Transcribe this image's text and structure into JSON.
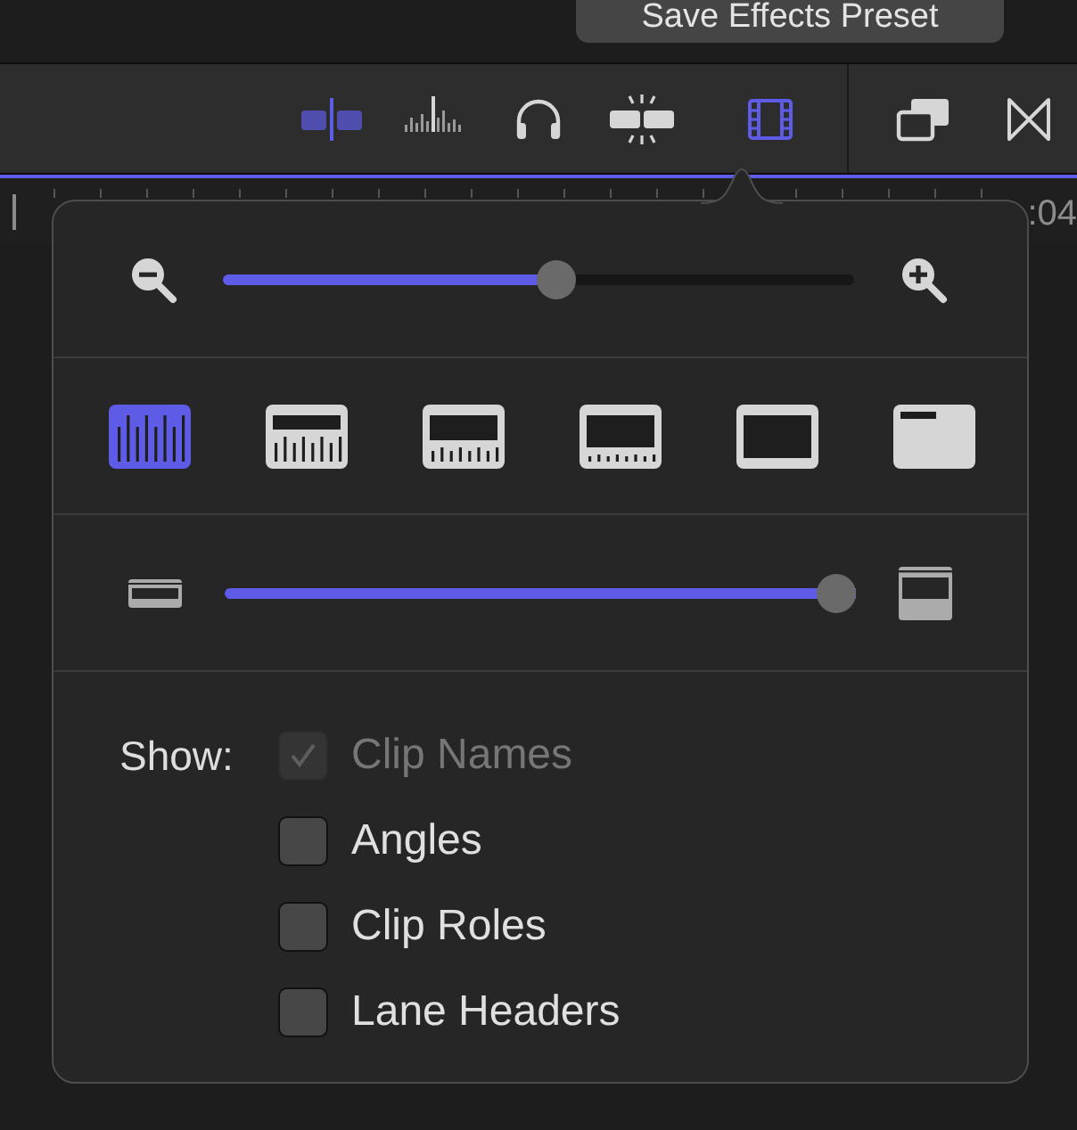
{
  "top_bar": {
    "button": "Save Effects Preset"
  },
  "toolbar": {
    "left": [
      {
        "kind": "skimming",
        "selected": true
      },
      {
        "kind": "audioskimming",
        "selected": false
      },
      {
        "kind": "solo",
        "selected": false
      },
      {
        "kind": "snapping",
        "selected": false
      },
      {
        "kind": "appearance",
        "selected": true
      }
    ],
    "right": [
      {
        "kind": "windows",
        "selected": false
      },
      {
        "kind": "transitions",
        "selected": false
      }
    ]
  },
  "ruler": {
    "timecode": ":04"
  },
  "popover": {
    "zoom": {
      "level": 0.53
    },
    "appearance_options": [
      {
        "kind": "waveforms",
        "selected": true
      },
      {
        "kind": "largewaveforms",
        "selected": false
      },
      {
        "kind": "equal",
        "selected": false
      },
      {
        "kind": "largefilmstrips",
        "selected": false
      },
      {
        "kind": "filmstrips",
        "selected": false
      },
      {
        "kind": "labels",
        "selected": false
      }
    ],
    "clip_height": {
      "level": 1.0
    },
    "show": {
      "label": "Show:",
      "options": [
        {
          "label": "Clip Names",
          "checked": true,
          "disabled": true
        },
        {
          "label": "Angles",
          "checked": false,
          "disabled": false
        },
        {
          "label": "Clip Roles",
          "checked": false,
          "disabled": false
        },
        {
          "label": "Lane Headers",
          "checked": false,
          "disabled": false
        }
      ]
    }
  }
}
